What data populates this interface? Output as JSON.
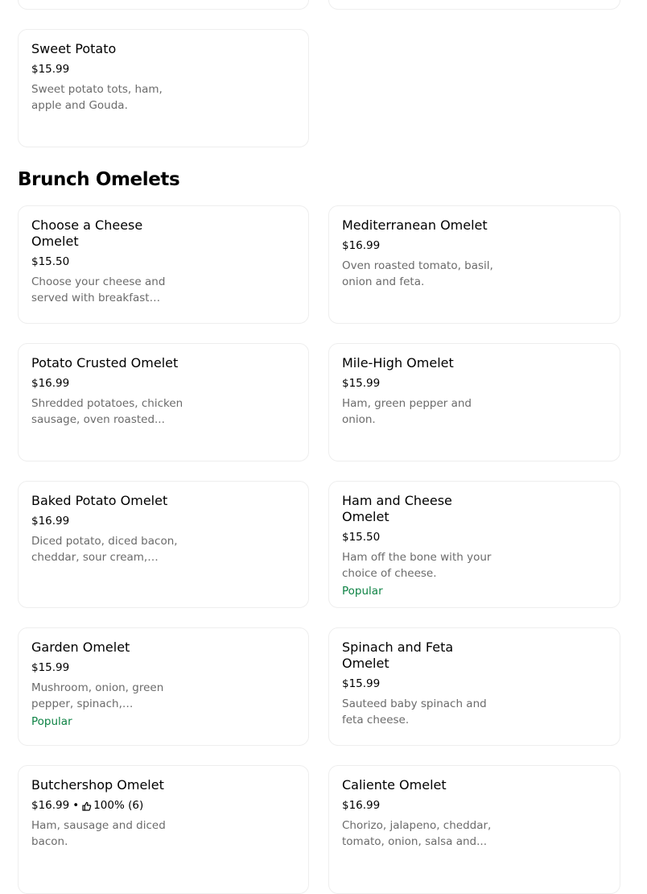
{
  "section": {
    "title": "Brunch Omelets"
  },
  "top_item": {
    "name": "Sweet Potato",
    "price": "$15.99",
    "description": "Sweet potato tots, ham, apple and Gouda."
  },
  "items": [
    {
      "name": "Choose a Cheese Omelet",
      "price": "$15.50",
      "description": "Choose your cheese and served with breakfast side..."
    },
    {
      "name": "Mediterranean Omelet",
      "price": "$16.99",
      "description": "Oven roasted tomato, basil, onion and feta."
    },
    {
      "name": "Potato Crusted Omelet",
      "price": "$16.99",
      "description": "Shredded potatoes, chicken sausage, oven roasted..."
    },
    {
      "name": "Mile-High Omelet",
      "price": "$15.99",
      "description": "Ham, green pepper and onion."
    },
    {
      "name": "Baked Potato Omelet",
      "price": "$16.99",
      "description": "Diced potato, diced bacon, cheddar, sour cream, green..."
    },
    {
      "name": "Ham and Cheese Omelet",
      "price": "$15.50",
      "description": "Ham off the bone with your choice of cheese.",
      "badge": "Popular"
    },
    {
      "name": "Garden Omelet",
      "price": "$15.99",
      "description": "Mushroom, onion, green pepper, spinach, asparagus...",
      "badge": "Popular"
    },
    {
      "name": "Spinach and Feta Omelet",
      "price": "$15.99",
      "description": "Sauteed baby spinach and feta cheese."
    },
    {
      "name": "Butchershop Omelet",
      "price": "$16.99",
      "rating_separator": "•",
      "rating_icon": "thumbs-up-icon",
      "rating": "100% (6)",
      "description": "Ham, sausage and diced bacon."
    },
    {
      "name": "Caliente Omelet",
      "price": "$16.99",
      "description": "Chorizo, jalapeno, cheddar, tomato, onion, salsa and..."
    }
  ],
  "colors": {
    "popular": "#0e8345",
    "description": "#6b6b6b",
    "border": "#eeeeee"
  }
}
